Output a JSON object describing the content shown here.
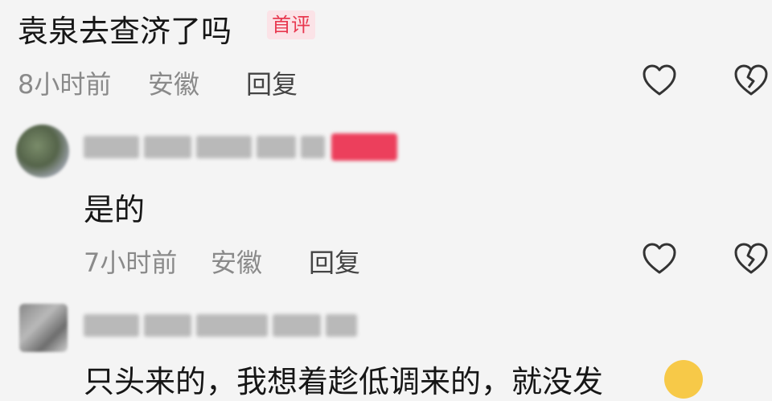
{
  "comments": [
    {
      "text": "袁泉去查济了吗",
      "badge": "首评",
      "time": "8小时前",
      "location": "安徽",
      "reply_label": "回复"
    },
    {
      "text": "是的",
      "time": "7小时前",
      "location": "安徽",
      "reply_label": "回复"
    },
    {
      "text": "只头来的，我想着趁低调来的，就没发"
    }
  ],
  "icons": {
    "like": "heart-outline-icon",
    "dislike": "broken-heart-icon",
    "emoji": "smile-emoji-icon"
  },
  "colors": {
    "badge_text": "#e8384f",
    "badge_bg": "#fbe3e7",
    "meta": "#8a8a8a",
    "background": "#f4f4f4"
  }
}
